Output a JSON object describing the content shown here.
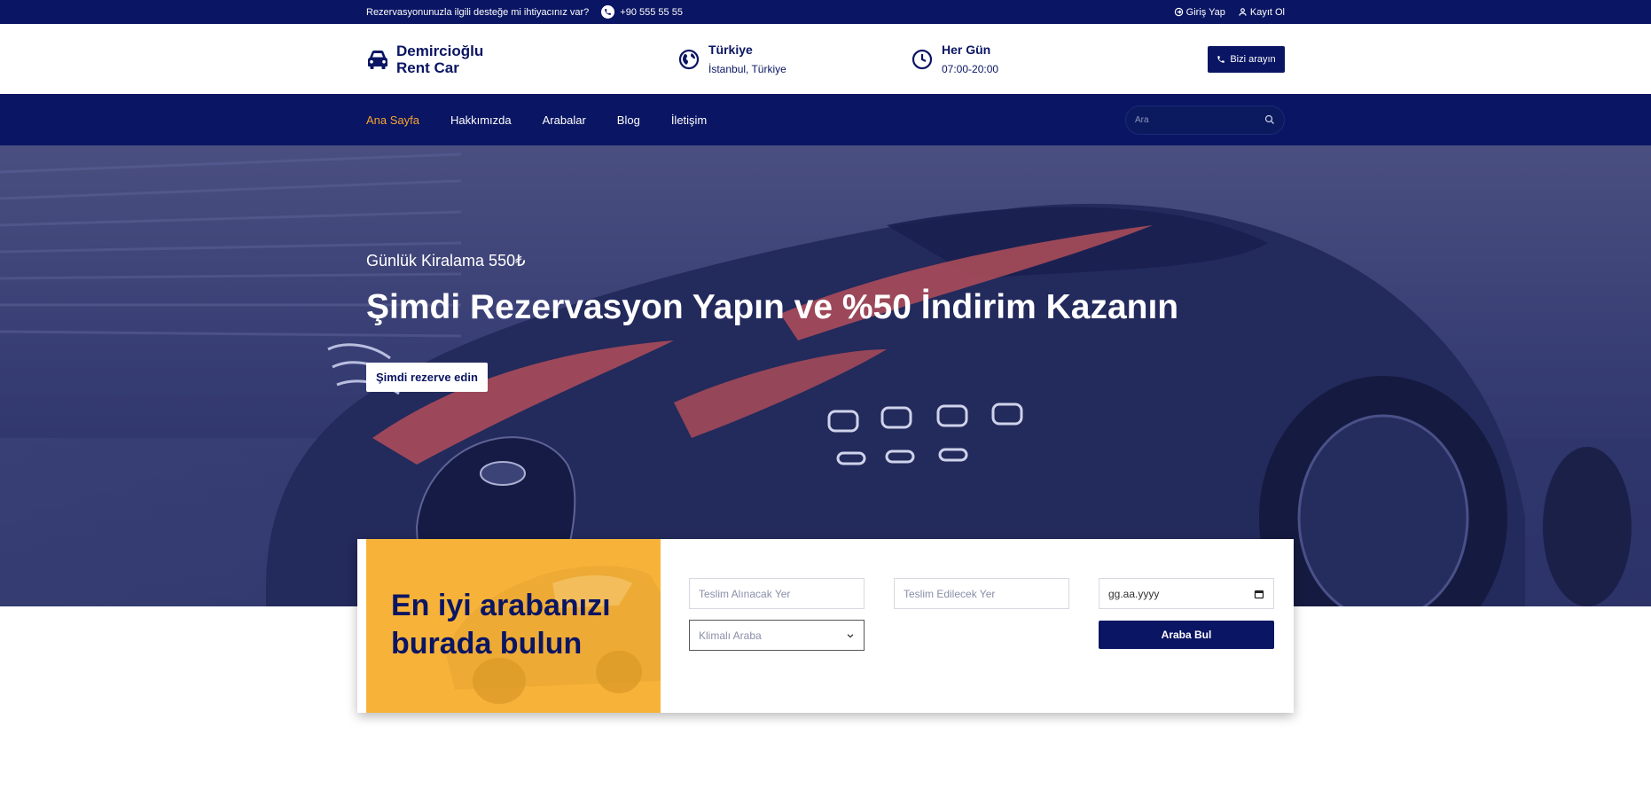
{
  "topbar": {
    "support_text": "Rezervasyonunuzla ilgili desteğe mi ihtiyacınız var?",
    "phone": "+90 555 55 55",
    "login": "Giriş Yap",
    "register": "Kayıt Ol"
  },
  "header": {
    "brand_line1": "Demircioğlu",
    "brand_line2": "Rent Car",
    "location_title": "Türkiye",
    "location_sub": "İstanbul, Türkiye",
    "hours_title": "Her Gün",
    "hours_sub": "07:00-20:00",
    "call_label": "Bizi arayın"
  },
  "nav": {
    "items": [
      {
        "label": "Ana Sayfa"
      },
      {
        "label": "Hakkımızda"
      },
      {
        "label": "Arabalar"
      },
      {
        "label": "Blog"
      },
      {
        "label": "İletişim"
      }
    ],
    "search_placeholder": "Ara"
  },
  "hero": {
    "subtitle": "Günlük Kiralama 550₺",
    "title": "Şimdi Rezervasyon Yapın ve %50 İndirim Kazanın",
    "cta": "Şimdi rezerve edin"
  },
  "booking": {
    "heading": "En iyi arabanızı burada bulun",
    "pickup_placeholder": "Teslim Alınacak Yer",
    "dropoff_placeholder": "Teslim Edilecek Yer",
    "date_placeholder": "gg.aa.yyyy",
    "car_type_selected": "Klimalı Araba",
    "find_button": "Araba Bul"
  },
  "colors": {
    "primary": "#0a1563",
    "accent": "#f7a531",
    "card_yellow": "#f7b339"
  }
}
